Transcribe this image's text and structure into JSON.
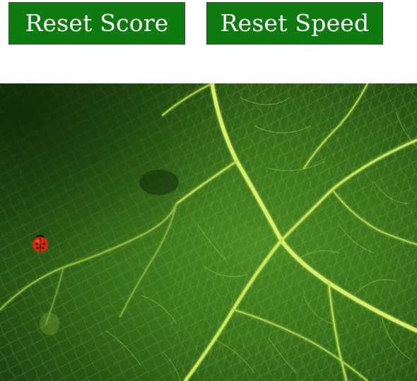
{
  "controls": {
    "reset_score_label": "Reset Score",
    "reset_speed_label": "Reset Speed",
    "button_color": "#0f7a0f",
    "button_text_color": "#ffffff"
  },
  "game": {
    "background": "leaf-texture",
    "target": "ladybug-icon",
    "target_color": "#d12a0c"
  }
}
